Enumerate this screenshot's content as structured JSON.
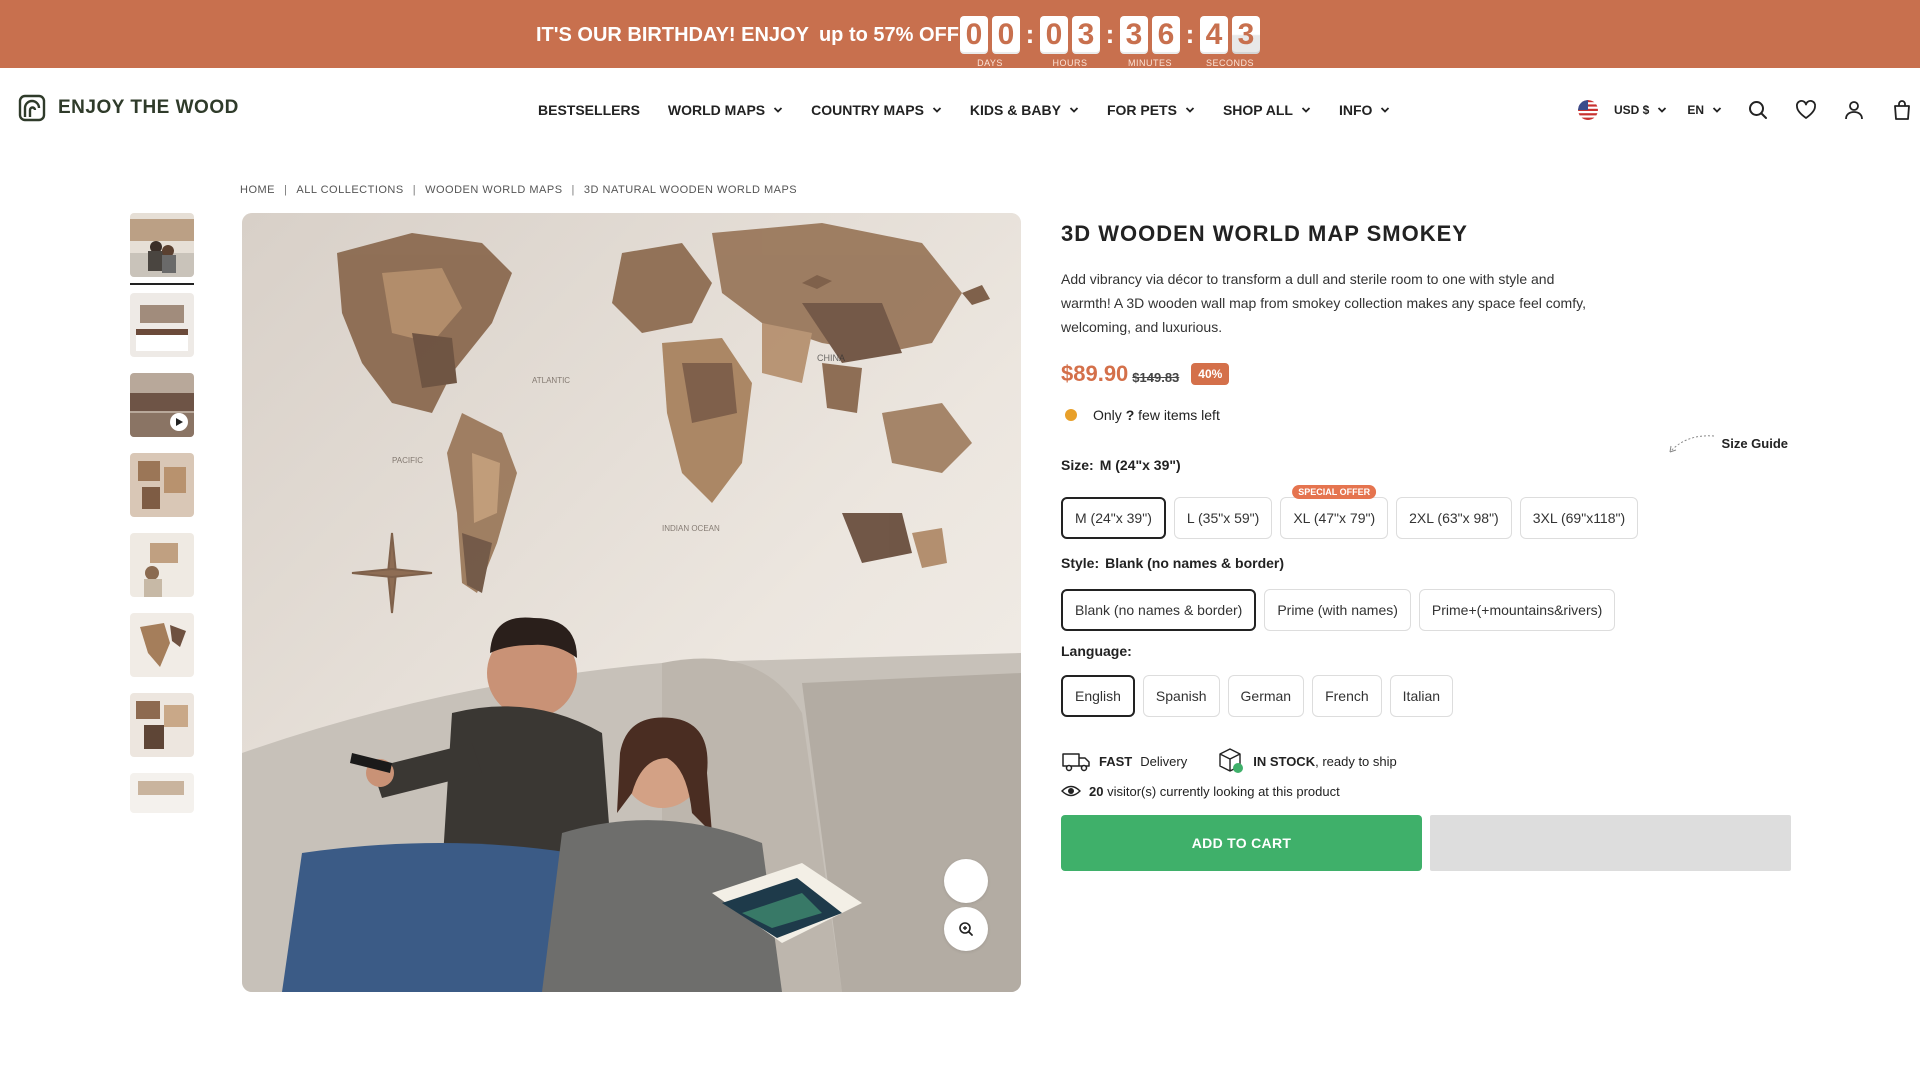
{
  "promo": {
    "text_main": "IT'S OUR BIRTHDAY! ENJOY",
    "text_offer": "up to 57% OFF",
    "timer": [
      {
        "digits": [
          "0",
          "0"
        ],
        "label": "DAYS"
      },
      {
        "digits": [
          "0",
          "3"
        ],
        "label": "HOURS"
      },
      {
        "digits": [
          "3",
          "6"
        ],
        "label": "MINUTES"
      },
      {
        "digits": [
          "4",
          "3"
        ],
        "label": "SECONDS"
      }
    ]
  },
  "header": {
    "logo_text": "ENJOY THE WOOD",
    "nav": [
      {
        "label": "BESTSELLERS",
        "dropdown": false
      },
      {
        "label": "WORLD MAPS",
        "dropdown": true
      },
      {
        "label": "COUNTRY MAPS",
        "dropdown": true
      },
      {
        "label": "KIDS & BABY",
        "dropdown": true
      },
      {
        "label": "FOR PETS",
        "dropdown": true
      },
      {
        "label": "SHOP ALL",
        "dropdown": true
      },
      {
        "label": "INFO",
        "dropdown": true
      }
    ],
    "currency": "USD $",
    "language": "EN"
  },
  "breadcrumb": [
    "HOME",
    "ALL COLLECTIONS",
    "WOODEN WORLD MAPS",
    "3D NATURAL WOODEN WORLD MAPS"
  ],
  "product": {
    "title": "3D WOODEN WORLD MAP SMOKEY",
    "description": "Add vibrancy via décor to transform a dull and sterile room to one with style and warmth! A 3D wooden wall map from smokey collection makes any space feel comfy, welcoming, and luxurious.",
    "price": "$89.90",
    "old_price": "$149.83",
    "discount": "40%",
    "stock_prefix": "Only",
    "stock_count": "?",
    "stock_suffix": "few items left",
    "size_label": "Size:",
    "size_value": "M (24\"x 39\")",
    "size_guide": "Size Guide",
    "sizes": [
      {
        "label": "M (24\"x 39\")",
        "selected": true,
        "badge": ""
      },
      {
        "label": "L (35\"x 59\")",
        "selected": false,
        "badge": ""
      },
      {
        "label": "XL (47\"x 79\")",
        "selected": false,
        "badge": "SPECIAL OFFER"
      },
      {
        "label": "2XL (63\"x 98\")",
        "selected": false,
        "badge": ""
      },
      {
        "label": "3XL (69\"x118\")",
        "selected": false,
        "badge": ""
      }
    ],
    "style_label": "Style:",
    "style_value": "Blank (no names & border)",
    "styles": [
      {
        "label": "Blank (no names & border)",
        "selected": true
      },
      {
        "label": "Prime (with names)",
        "selected": false
      },
      {
        "label": "Prime+(+mountains&rivers)",
        "selected": false
      }
    ],
    "language_label": "Language:",
    "languages": [
      {
        "label": "English",
        "selected": true
      },
      {
        "label": "Spanish",
        "selected": false
      },
      {
        "label": "German",
        "selected": false
      },
      {
        "label": "French",
        "selected": false
      },
      {
        "label": "Italian",
        "selected": false
      }
    ],
    "delivery_bold": "FAST",
    "delivery_text": "Delivery",
    "instock_bold": "IN STOCK",
    "instock_text": ", ready to ship",
    "visitors_count": "20",
    "visitors_text": "visitor(s) currently looking at this product",
    "add_to_cart": "ADD TO CART"
  },
  "colors": {
    "promo_bg": "#c8704e",
    "price": "#d4704a",
    "cart_button": "#3fb06a",
    "stock_dot": "#e8a02a"
  }
}
